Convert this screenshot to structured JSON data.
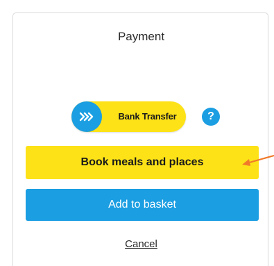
{
  "payment": {
    "title": "Payment",
    "bank_transfer_label": "Bank Transfer",
    "help_symbol": "?",
    "book_label": "Book meals and places",
    "basket_label": "Add to basket",
    "cancel_label": "Cancel"
  },
  "icons": {
    "bank_transfer": "chevrons-right-icon",
    "help": "question-icon",
    "annotation": "arrow-left-icon"
  },
  "colors": {
    "primary_blue": "#1b9ee2",
    "accent_yellow": "#fde217",
    "annotation_orange": "#f07a2a"
  }
}
